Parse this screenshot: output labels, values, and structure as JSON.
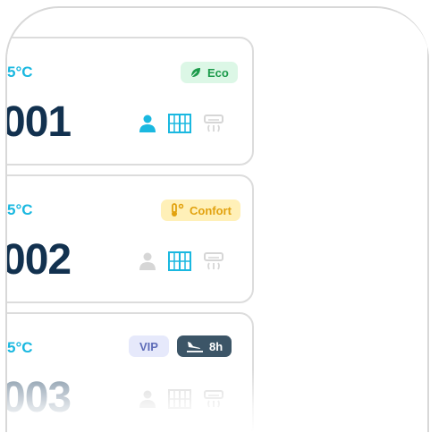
{
  "rooms": [
    {
      "temp": "5°C",
      "number": "001",
      "badge": {
        "label": "Eco",
        "icon": "leaf-icon"
      },
      "icons": {
        "person": "active",
        "window": "active",
        "ac": "inactive"
      }
    },
    {
      "temp": "5°C",
      "number": "002",
      "badge": {
        "label": "Confort",
        "icon": "thermometer-icon"
      },
      "icons": {
        "person": "inactive",
        "window": "active",
        "ac": "inactive"
      }
    },
    {
      "temp": "5°C",
      "number": "003",
      "badges": [
        {
          "label": "VIP"
        },
        {
          "label": "8h",
          "icon": "plane-landing-icon"
        }
      ],
      "icons": {
        "person": "inactive",
        "window": "inactive",
        "ac": "inactive"
      }
    }
  ],
  "colors": {
    "accent": "#1ab8e0",
    "number": "#12314f",
    "inactive_icon": "#d6d6d6",
    "eco_bg": "#dcf7e6",
    "eco_fg": "#1b9a4a",
    "confort_bg": "#fff0b8",
    "confort_fg": "#e2a20f",
    "vip_bg": "#e6e9fb",
    "vip_fg": "#5e6cb8",
    "flight_bg": "#3c5567"
  }
}
